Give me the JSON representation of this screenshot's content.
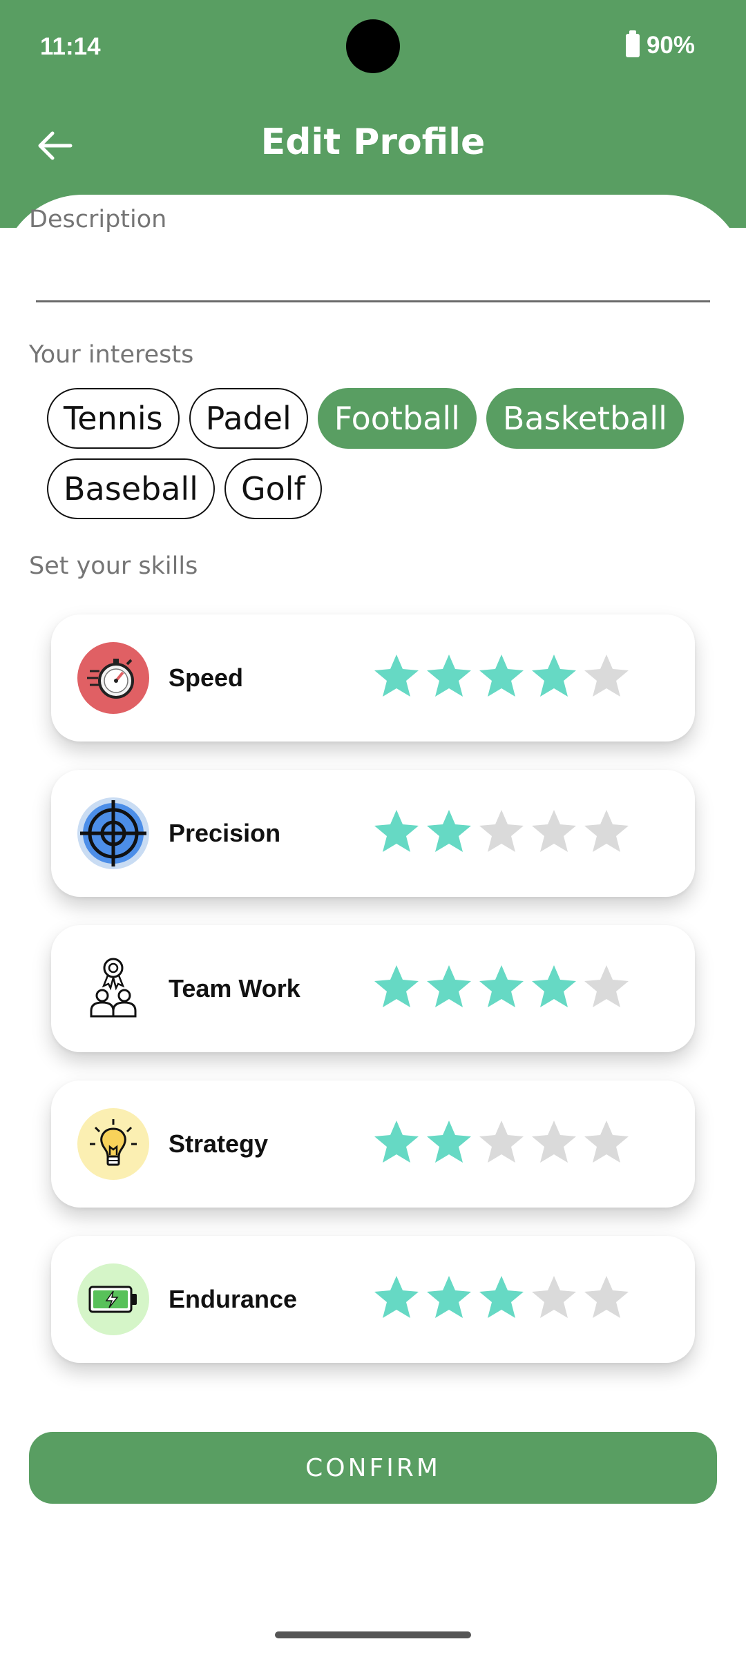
{
  "status_bar": {
    "time": "11:14",
    "battery": "90%"
  },
  "header": {
    "title": "Edit Profile"
  },
  "description": {
    "label": "Description",
    "value": ""
  },
  "interests": {
    "label": "Your interests",
    "rows": [
      [
        {
          "label": "Tennis",
          "selected": false
        },
        {
          "label": "Padel",
          "selected": false
        },
        {
          "label": "Football",
          "selected": true
        },
        {
          "label": "Basketball",
          "selected": true
        }
      ],
      [
        {
          "label": "Baseball",
          "selected": false
        },
        {
          "label": "Golf",
          "selected": false
        }
      ]
    ]
  },
  "skills": {
    "label": "Set your skills",
    "max_rating": 5,
    "items": [
      {
        "name": "Speed",
        "rating": 4,
        "icon": "stopwatch-icon"
      },
      {
        "name": "Precision",
        "rating": 2,
        "icon": "target-icon"
      },
      {
        "name": "Team Work",
        "rating": 4,
        "icon": "team-award-icon"
      },
      {
        "name": "Strategy",
        "rating": 2,
        "icon": "lightbulb-icon"
      },
      {
        "name": "Endurance",
        "rating": 3,
        "icon": "battery-icon"
      }
    ]
  },
  "confirm_label": "CONFIRM",
  "colors": {
    "primary": "#599e62",
    "star_filled": "#66d9c4",
    "star_empty": "#dadada"
  }
}
